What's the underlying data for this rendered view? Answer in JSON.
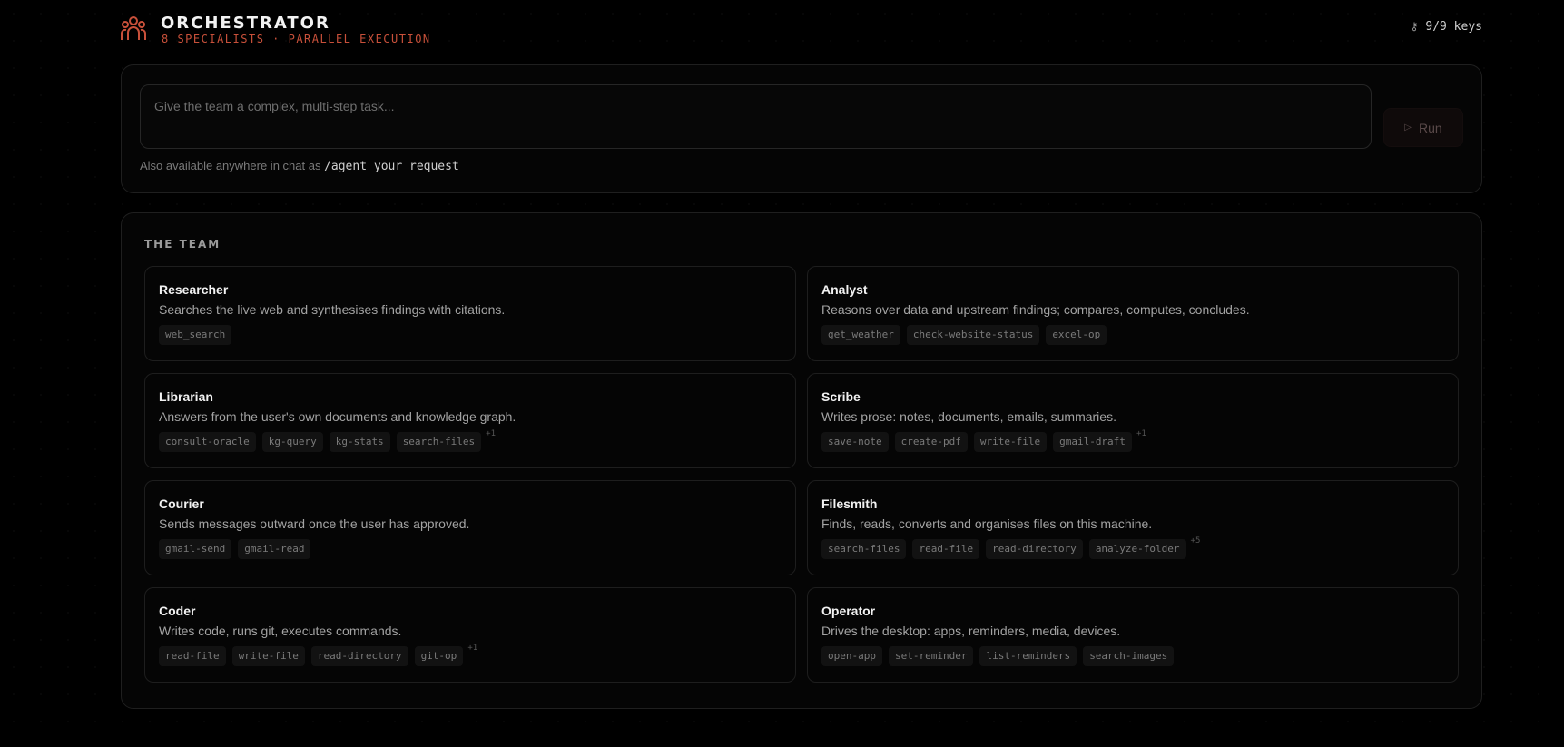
{
  "header": {
    "title": "ORCHESTRATOR",
    "subtitle": "8 SPECIALISTS · PARALLEL EXECUTION",
    "keys_label": "9/9 keys",
    "logo_icon": "team-icon",
    "key_icon": "key-icon"
  },
  "task": {
    "placeholder": "Give the team a complex, multi-step task...",
    "value": "",
    "run_label": "Run",
    "hint_prefix": "Also available anywhere in chat as",
    "hint_command": "/agent your request"
  },
  "team": {
    "heading": "THE TEAM",
    "agents": [
      {
        "name": "Researcher",
        "description": "Searches the live web and synthesises findings with citations.",
        "tools": [
          "web_search"
        ],
        "more": ""
      },
      {
        "name": "Analyst",
        "description": "Reasons over data and upstream findings; compares, computes, concludes.",
        "tools": [
          "get_weather",
          "check-website-status",
          "excel-op"
        ],
        "more": ""
      },
      {
        "name": "Librarian",
        "description": "Answers from the user's own documents and knowledge graph.",
        "tools": [
          "consult-oracle",
          "kg-query",
          "kg-stats",
          "search-files"
        ],
        "more": "+1"
      },
      {
        "name": "Scribe",
        "description": "Writes prose: notes, documents, emails, summaries.",
        "tools": [
          "save-note",
          "create-pdf",
          "write-file",
          "gmail-draft"
        ],
        "more": "+1"
      },
      {
        "name": "Courier",
        "description": "Sends messages outward once the user has approved.",
        "tools": [
          "gmail-send",
          "gmail-read"
        ],
        "more": ""
      },
      {
        "name": "Filesmith",
        "description": "Finds, reads, converts and organises files on this machine.",
        "tools": [
          "search-files",
          "read-file",
          "read-directory",
          "analyze-folder"
        ],
        "more": "+5"
      },
      {
        "name": "Coder",
        "description": "Writes code, runs git, executes commands.",
        "tools": [
          "read-file",
          "write-file",
          "read-directory",
          "git-op"
        ],
        "more": "+1"
      },
      {
        "name": "Operator",
        "description": "Drives the desktop: apps, reminders, media, devices.",
        "tools": [
          "open-app",
          "set-reminder",
          "list-reminders",
          "search-images"
        ],
        "more": ""
      }
    ]
  },
  "colors": {
    "accent": "#c8503a",
    "background": "#000000",
    "panel_border": "#1f1f1f"
  }
}
